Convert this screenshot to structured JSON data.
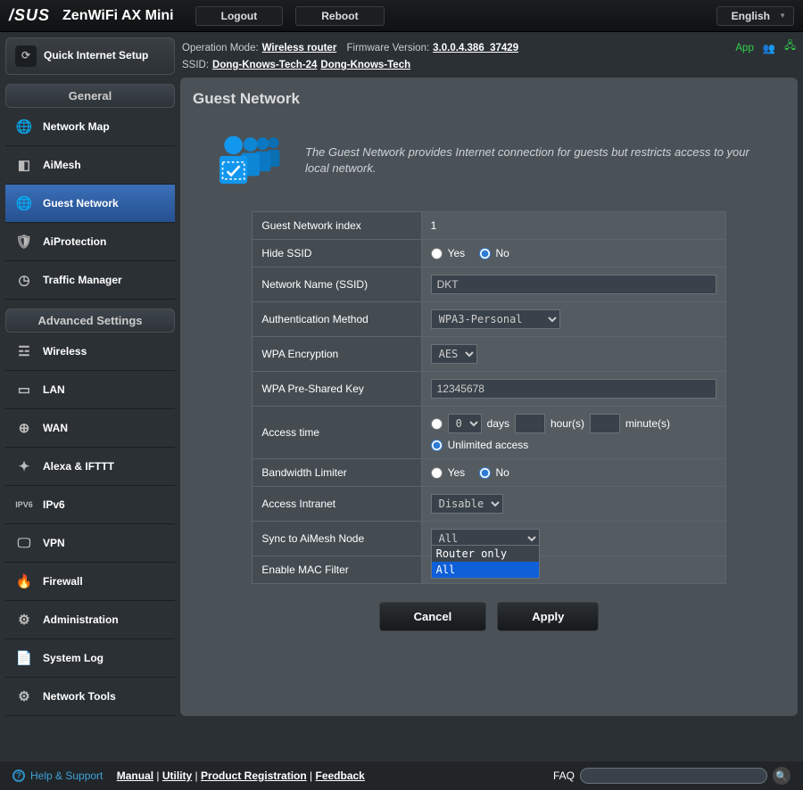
{
  "brand": "/SUS",
  "model": "ZenWiFi AX Mini",
  "top_buttons": {
    "logout": "Logout",
    "reboot": "Reboot"
  },
  "language": "English",
  "info": {
    "op_mode_label": "Operation Mode:",
    "op_mode": "Wireless router",
    "fw_label": "Firmware Version:",
    "fw": "3.0.0.4.386_37429",
    "ssid_label": "SSID:",
    "ssid1": "Dong-Knows-Tech-24",
    "ssid2": "Dong-Knows-Tech",
    "app_label": "App"
  },
  "qis": "Quick Internet Setup",
  "section_general": "General",
  "nav_general": [
    {
      "label": "Network Map",
      "selected": false
    },
    {
      "label": "AiMesh",
      "selected": false
    },
    {
      "label": "Guest Network",
      "selected": true
    },
    {
      "label": "AiProtection",
      "selected": false
    },
    {
      "label": "Traffic Manager",
      "selected": false
    }
  ],
  "section_advanced": "Advanced Settings",
  "nav_advanced": [
    {
      "label": "Wireless"
    },
    {
      "label": "LAN"
    },
    {
      "label": "WAN"
    },
    {
      "label": "Alexa & IFTTT"
    },
    {
      "label": "IPv6"
    },
    {
      "label": "VPN"
    },
    {
      "label": "Firewall"
    },
    {
      "label": "Administration"
    },
    {
      "label": "System Log"
    },
    {
      "label": "Network Tools"
    }
  ],
  "page_title": "Guest Network",
  "page_desc": "The Guest Network provides Internet connection for guests but restricts access to your local network.",
  "form": {
    "index_label": "Guest Network index",
    "index": "1",
    "hide_ssid_label": "Hide SSID",
    "yes": "Yes",
    "no": "No",
    "ssid_label": "Network Name (SSID)",
    "ssid": "DKT",
    "auth_label": "Authentication Method",
    "auth": "WPA3-Personal",
    "enc_label": "WPA Encryption",
    "enc": "AES",
    "psk_label": "WPA Pre-Shared Key",
    "psk": "12345678",
    "access_time_label": "Access time",
    "access_days": "0",
    "days_text": "days",
    "hours_text": "hour(s)",
    "mins_text": "minute(s)",
    "unlimited": "Unlimited access",
    "bw_label": "Bandwidth Limiter",
    "intranet_label": "Access Intranet",
    "intranet": "Disable",
    "sync_label": "Sync to AiMesh Node",
    "sync": "All",
    "sync_options": {
      "router_only": "Router only",
      "all": "All"
    },
    "mac_label": "Enable MAC Filter"
  },
  "buttons": {
    "cancel": "Cancel",
    "apply": "Apply"
  },
  "footer": {
    "help": "Help & Support",
    "manual": "Manual",
    "utility": "Utility",
    "reg": "Product Registration",
    "feedback": "Feedback",
    "faq": "FAQ"
  }
}
